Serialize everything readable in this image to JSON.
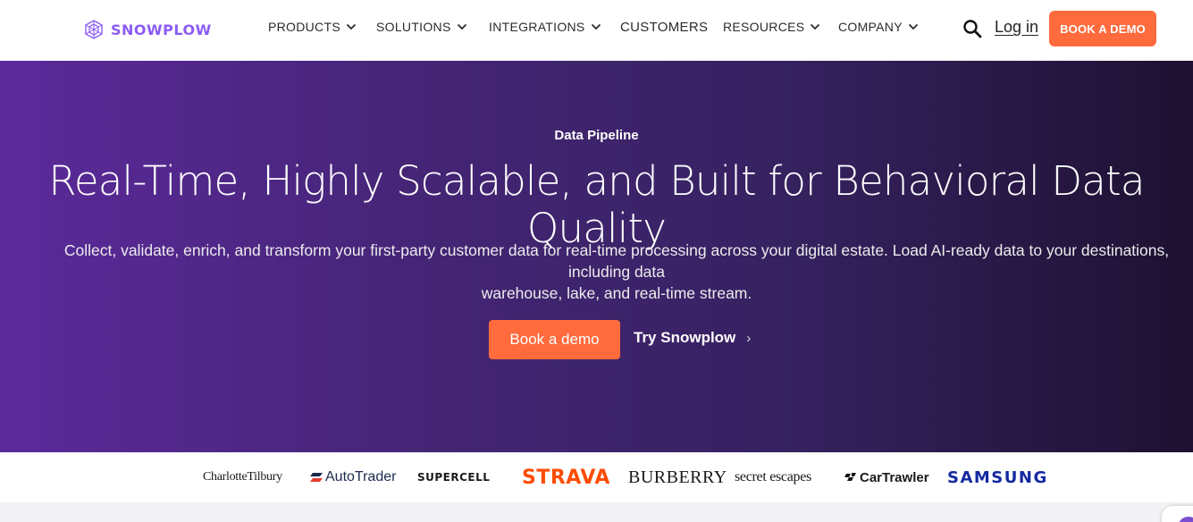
{
  "nav": {
    "logo_text": "SNOWPLOW",
    "items": [
      {
        "label": "PRODUCTS",
        "has_dropdown": true
      },
      {
        "label": "SOLUTIONS",
        "has_dropdown": true
      },
      {
        "label": "INTEGRATIONS",
        "has_dropdown": true
      },
      {
        "label": "CUSTOMERS",
        "has_dropdown": false
      },
      {
        "label": "RESOURCES",
        "has_dropdown": true
      },
      {
        "label": "COMPANY",
        "has_dropdown": true
      }
    ],
    "login_label": "Log in",
    "cta_label": "BOOK A DEMO"
  },
  "hero": {
    "eyebrow": "Data Pipeline",
    "title": "Real-Time, Highly Scalable, and Built for Behavioral Data Quality",
    "subtitle_line1": "Collect, validate, enrich, and transform your first-party customer data for real-time processing across your digital estate. Load AI-ready data to your destinations, including data",
    "subtitle_line2": "warehouse, lake, and real-time stream.",
    "primary_cta": "Book a demo",
    "secondary_cta": "Try Snowplow",
    "secondary_arrow": "›"
  },
  "customers": {
    "logos": [
      "CharlotteTilbury",
      "AutoTrader",
      "SUPERCELL",
      "STRAVA",
      "BURBERRY",
      "secret escapes",
      "CarTrawler",
      "SAMSUNG"
    ]
  },
  "colors": {
    "accent": "#ff6b3d",
    "brand": "#8b5cf6",
    "hero_start": "#5b2a9b",
    "hero_end": "#1d1131"
  }
}
